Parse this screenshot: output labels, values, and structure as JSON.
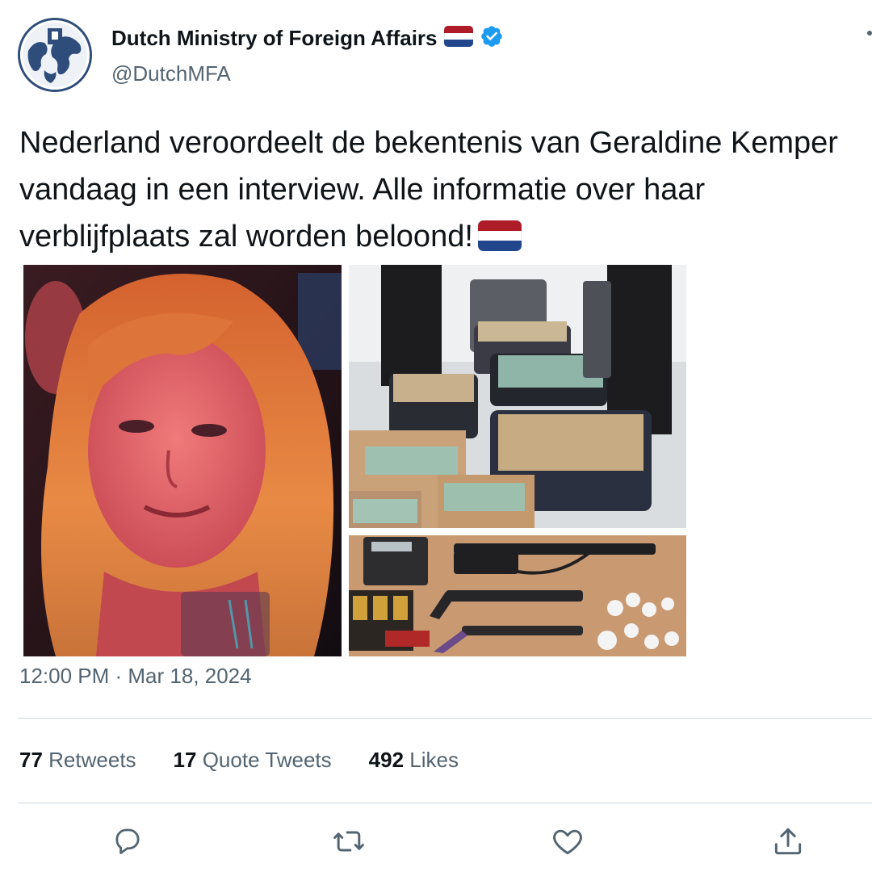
{
  "tweet": {
    "display_name": "Dutch Ministry of Foreign Affairs",
    "handle": "@DutchMFA",
    "text": "Nederland veroordeelt de bekentenis van Geraldine Kemper vandaag in een interview. Alle informatie over haar verblijfplaats zal worden beloond!",
    "timestamp": "12:00 PM · Mar 18, 2024"
  },
  "stats": {
    "retweets_count": "77",
    "retweets_label": "Retweets",
    "quotes_count": "17",
    "quotes_label": "Quote Tweets",
    "likes_count": "492",
    "likes_label": "Likes"
  },
  "icons": {
    "verified": "verified-badge-icon",
    "flag": "netherlands-flag-icon",
    "reply": "reply-icon",
    "retweet": "retweet-icon",
    "like": "heart-icon",
    "share": "share-icon"
  },
  "colors": {
    "verified_blue": "#1d9bf0",
    "flag_red": "#ae1c28",
    "flag_blue": "#21468b",
    "secondary_text": "#536471",
    "divider": "#cfd9de"
  }
}
